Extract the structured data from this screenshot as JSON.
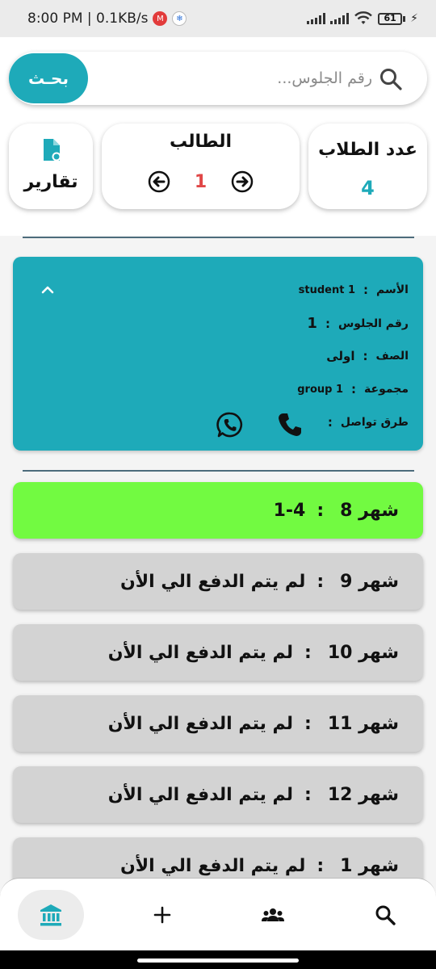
{
  "status_bar": {
    "time_speed": "8:00 PM | 0.1KB/s",
    "battery": "61"
  },
  "search": {
    "button_label": "بحـث",
    "placeholder": "رقم الجلوس..."
  },
  "stats": {
    "count_title": "عدد الطلاب",
    "count_value": "4",
    "student_title": "الطالب",
    "current_student": "1",
    "reports_label": "تقارير"
  },
  "student_info": {
    "name_label": "الأسم",
    "name_value": "student 1",
    "seat_label": "رقم الجلوس",
    "seat_value": "1",
    "class_label": "الصف",
    "class_value": "اولى",
    "group_label": "مجموعة",
    "group_value": "group 1",
    "contact_label": "طرق تواصل",
    "separator": ":"
  },
  "months": [
    {
      "label": "شهر 8",
      "status": "1-4",
      "paid": true
    },
    {
      "label": "شهر 9",
      "status": "لم يتم الدفع الي الأن",
      "paid": false
    },
    {
      "label": "شهر 10",
      "status": "لم يتم الدفع الي الأن",
      "paid": false
    },
    {
      "label": "شهر 11",
      "status": "لم يتم الدفع الي الأن",
      "paid": false
    },
    {
      "label": "شهر 12",
      "status": "لم يتم الدفع الي الأن",
      "paid": false
    },
    {
      "label": "شهر 1",
      "status": "لم يتم الدفع الي الأن",
      "paid": false
    }
  ],
  "month_separator": ":",
  "nav": {
    "items": [
      "bank-icon",
      "plus-icon",
      "group-icon",
      "search-icon"
    ],
    "active": "bank-icon"
  },
  "colors": {
    "accent": "#1eaab9",
    "paid": "#72fa41",
    "unpaid": "#d3d3d3",
    "pager_number": "#e04747"
  }
}
